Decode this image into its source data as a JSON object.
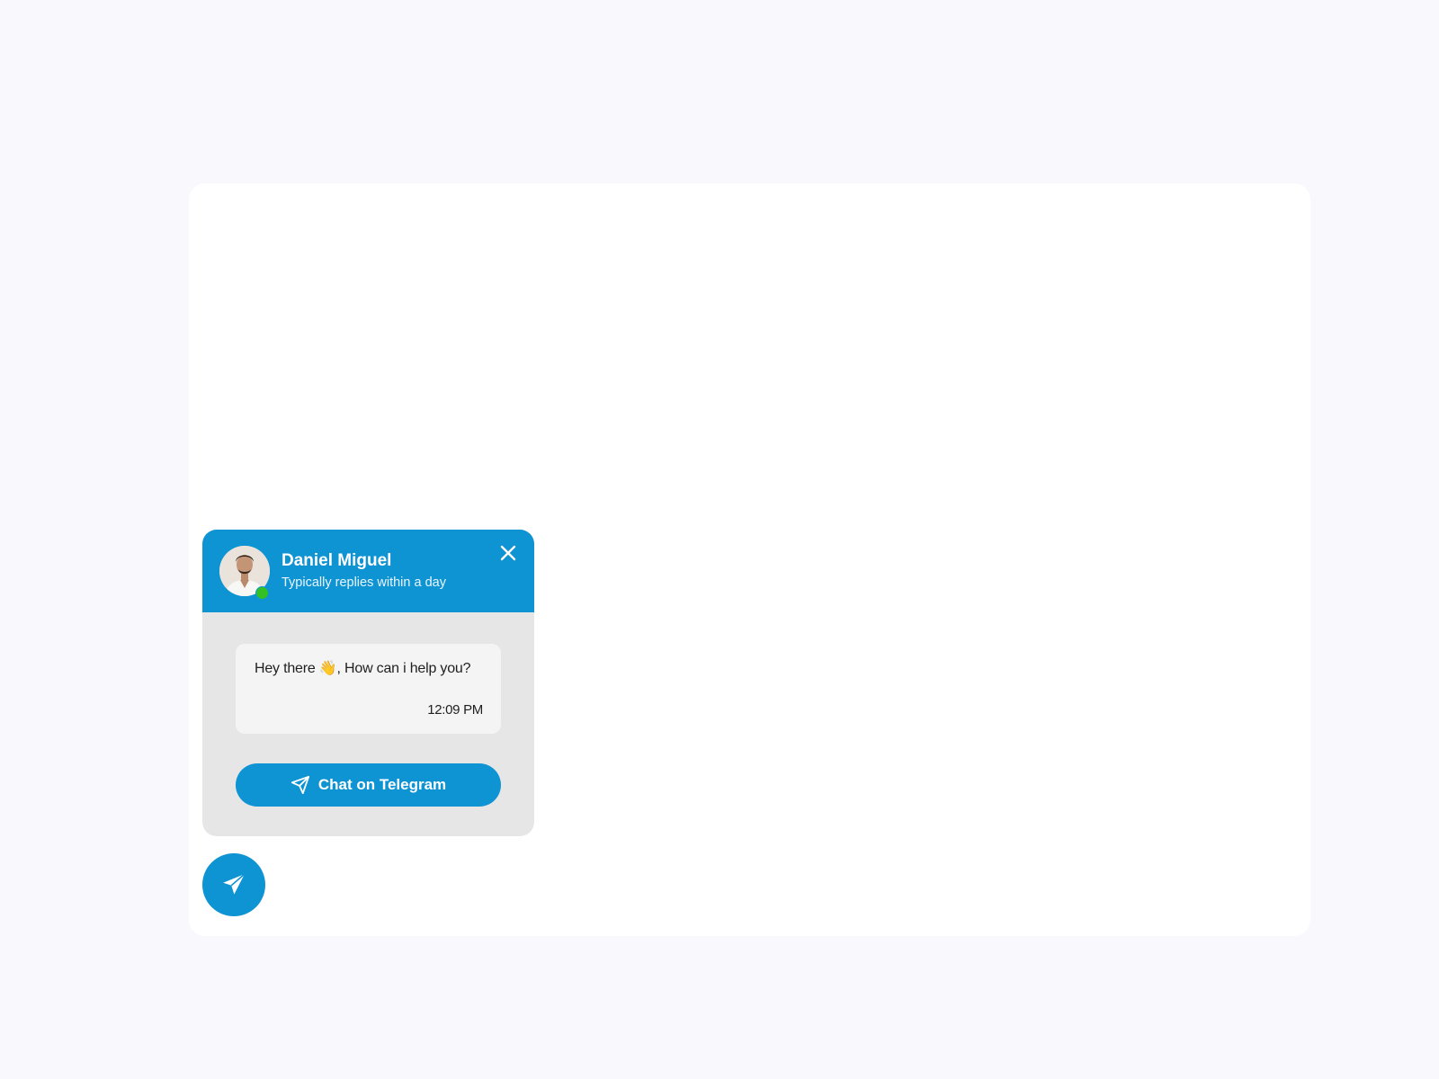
{
  "widget": {
    "agent_name": "Daniel Miguel",
    "agent_status": "Typically replies within a day",
    "message": {
      "text": "Hey there 👋, How can i help you?",
      "time": "12:09 PM"
    },
    "cta_label": "Chat on Telegram"
  },
  "icons": {
    "close": "close-icon",
    "send": "paper-plane-icon",
    "online": "online-status-dot"
  },
  "colors": {
    "brand": "#0e93d3",
    "online": "#34c023",
    "panel": "#e6e6e6",
    "bubble": "#f4f4f4",
    "page": "#f9f8fd"
  }
}
